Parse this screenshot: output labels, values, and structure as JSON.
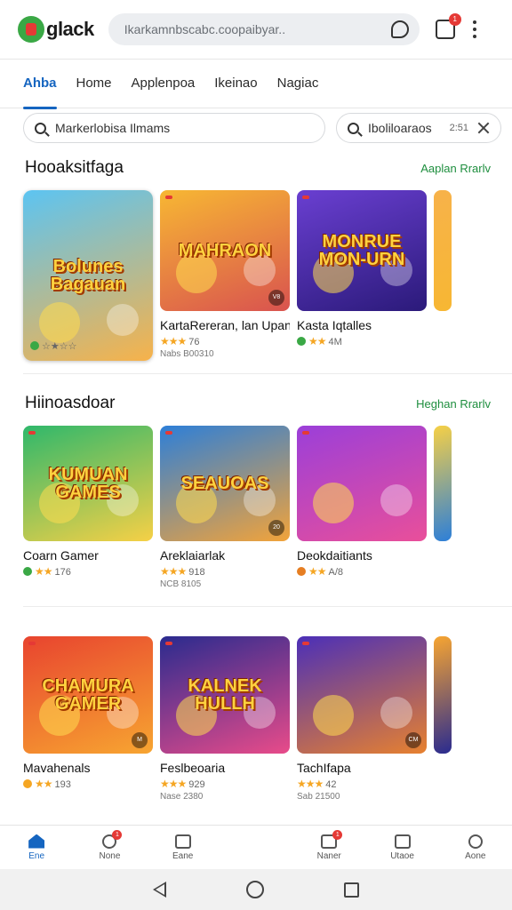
{
  "app": {
    "logo_text": "glack",
    "search_placeholder": "Ikarkamnbscabc.coopaibyar..",
    "cart_badge": "1"
  },
  "tabs": [
    {
      "label": "Ahba",
      "active": true
    },
    {
      "label": "Home"
    },
    {
      "label": "Applenpoa"
    },
    {
      "label": "Ikeinao"
    },
    {
      "label": "Nagiac"
    }
  ],
  "filters": {
    "left_text": "Markerlobisa Ilmams",
    "right_text": "Iboliloaraos",
    "right_count": "2:51"
  },
  "sections": [
    {
      "title": "Hooaksitfaga",
      "link": "Aaplan Rrarlv",
      "cards": [
        {
          "art": "Bolunes Bagauan",
          "name": "",
          "stars": "★★",
          "rating_text": "☆★☆☆",
          "meta": "",
          "colors": [
            "#5cc4f2",
            "#f7b24a"
          ],
          "badge": "#3aa845",
          "feature": true
        },
        {
          "art": "MAHRAON",
          "name": "KartaRereran, lan Upanil",
          "stars": "★★★",
          "rating_text": "76",
          "meta": "Nabs B00310",
          "colors": [
            "#f7b733",
            "#d9534f"
          ],
          "corner": "V8"
        },
        {
          "art": "MONRUE MON-URN",
          "name": "Kasta Iqtalles",
          "stars": "★★",
          "rating_text": "4M",
          "meta": "",
          "colors": [
            "#6a3fd1",
            "#2b1a7a"
          ],
          "badge": "#3aa845",
          "corner": ""
        }
      ]
    },
    {
      "title": "Hiinoasdoar",
      "link": "Heghan Rrarlv",
      "cards": [
        {
          "art": "KUMUAN GAMES",
          "name": "Coarn Gamer",
          "stars": "★★",
          "rating_text": "176",
          "meta": "",
          "colors": [
            "#2fb86b",
            "#f6d046"
          ],
          "badge": "#3aa845"
        },
        {
          "art": "SEAUOAS",
          "name": "Areklaiarlak",
          "stars": "★★★",
          "rating_text": "918",
          "meta": "NCB 8105",
          "colors": [
            "#2d7fd8",
            "#f2a33a"
          ],
          "corner": "20"
        },
        {
          "art": "",
          "name": "Deokdaitiants",
          "stars": "★★",
          "rating_text": "A/8",
          "meta": "",
          "colors": [
            "#9b3fd9",
            "#e94f9a"
          ],
          "badge": "#e67e22"
        }
      ]
    },
    {
      "title": "",
      "link": "",
      "cards": [
        {
          "art": "CHAMURA GAMER",
          "name": "Mavahenals",
          "stars": "★★",
          "rating_text": "193",
          "meta": "",
          "colors": [
            "#e8442f",
            "#f7a531"
          ],
          "badge": "#f5a623",
          "corner": "M"
        },
        {
          "art": "KALNEK HULLH",
          "name": "Feslbeoaria",
          "stars": "★★★",
          "rating_text": "929",
          "meta": "Nase 2380",
          "colors": [
            "#2a2b8f",
            "#e84b8a"
          ]
        },
        {
          "art": "",
          "name": "TachIfapa",
          "stars": "★★★",
          "rating_text": "42",
          "meta": "Sab 21500",
          "colors": [
            "#4b2fb8",
            "#e7812f"
          ],
          "corner": "CM"
        }
      ]
    }
  ],
  "bottom_nav": [
    {
      "label": "Ene",
      "icon": "home-icon",
      "active": true
    },
    {
      "label": "None",
      "icon": "chat-icon",
      "badge": "1"
    },
    {
      "label": "Eane",
      "icon": "calendar-icon"
    },
    {
      "label": "",
      "icon": ""
    },
    {
      "label": "Naner",
      "icon": "news-icon",
      "badge": "1"
    },
    {
      "label": "Utaoe",
      "icon": "gift-icon"
    },
    {
      "label": "Aone",
      "icon": "account-icon"
    }
  ]
}
